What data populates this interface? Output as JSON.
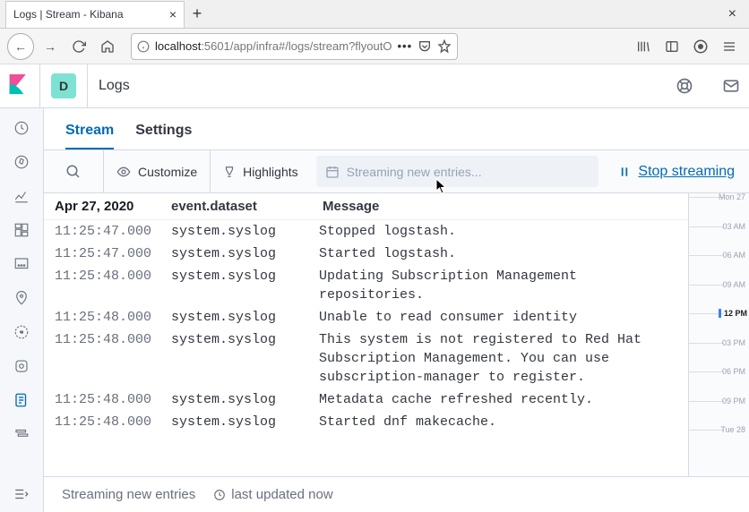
{
  "browser": {
    "tab_title": "Logs | Stream - Kibana",
    "url_host": "localhost",
    "url_path": ":5601/app/infra#/logs/stream?flyoutO"
  },
  "kibana": {
    "space_initial": "D",
    "breadcrumb": "Logs",
    "tabs": {
      "stream": "Stream",
      "settings": "Settings"
    },
    "toolbar": {
      "customize": "Customize",
      "highlights": "Highlights",
      "stream_placeholder": "Streaming new entries...",
      "stop": "Stop streaming"
    },
    "columns": {
      "date": "Apr 27, 2020",
      "dataset": "event.dataset",
      "message": "Message"
    },
    "rows": [
      {
        "ts": "11:25:47.000",
        "ds": "system.syslog",
        "msg": "Stopped logstash."
      },
      {
        "ts": "11:25:47.000",
        "ds": "system.syslog",
        "msg": "Started logstash."
      },
      {
        "ts": "11:25:48.000",
        "ds": "system.syslog",
        "msg": "Updating Subscription Management repositories."
      },
      {
        "ts": "11:25:48.000",
        "ds": "system.syslog",
        "msg": "Unable to read consumer identity"
      },
      {
        "ts": "11:25:48.000",
        "ds": "system.syslog",
        "msg": "This system is not registered to Red Hat Subscription Management. You can use subscription-manager to register."
      },
      {
        "ts": "11:25:48.000",
        "ds": "system.syslog",
        "msg": "Metadata cache refreshed recently."
      },
      {
        "ts": "11:25:48.000",
        "ds": "system.syslog",
        "msg": "Started dnf makecache."
      }
    ],
    "minimap": [
      "Mon 27",
      "03 AM",
      "06 AM",
      "09 AM",
      "12 PM",
      "03 PM",
      "06 PM",
      "09 PM",
      "Tue 28"
    ],
    "minimap_emph_index": 4,
    "footer": {
      "status": "Streaming new entries",
      "updated": "last updated now"
    }
  }
}
